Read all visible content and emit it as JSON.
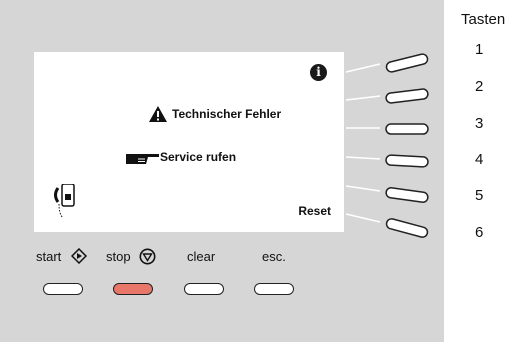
{
  "display": {
    "info_icon": "info-icon",
    "message_error": "Technischer Fehler",
    "message_service": "Service rufen",
    "reset_label": "Reset",
    "phone_icon": "handset-phone-icon"
  },
  "legend": {
    "title": "Tasten",
    "numbers": [
      "1",
      "2",
      "3",
      "4",
      "5",
      "6"
    ]
  },
  "function_keys": [
    {
      "label": "start",
      "icon": "diamond-arrow-icon"
    },
    {
      "label": "stop",
      "icon": "circle-triangle-icon"
    },
    {
      "label": "clear",
      "icon": ""
    },
    {
      "label": "esc.",
      "icon": ""
    }
  ],
  "colors": {
    "panel": "#d6d6d6",
    "screen": "#ffffff",
    "stop_key": "#e8776a"
  }
}
